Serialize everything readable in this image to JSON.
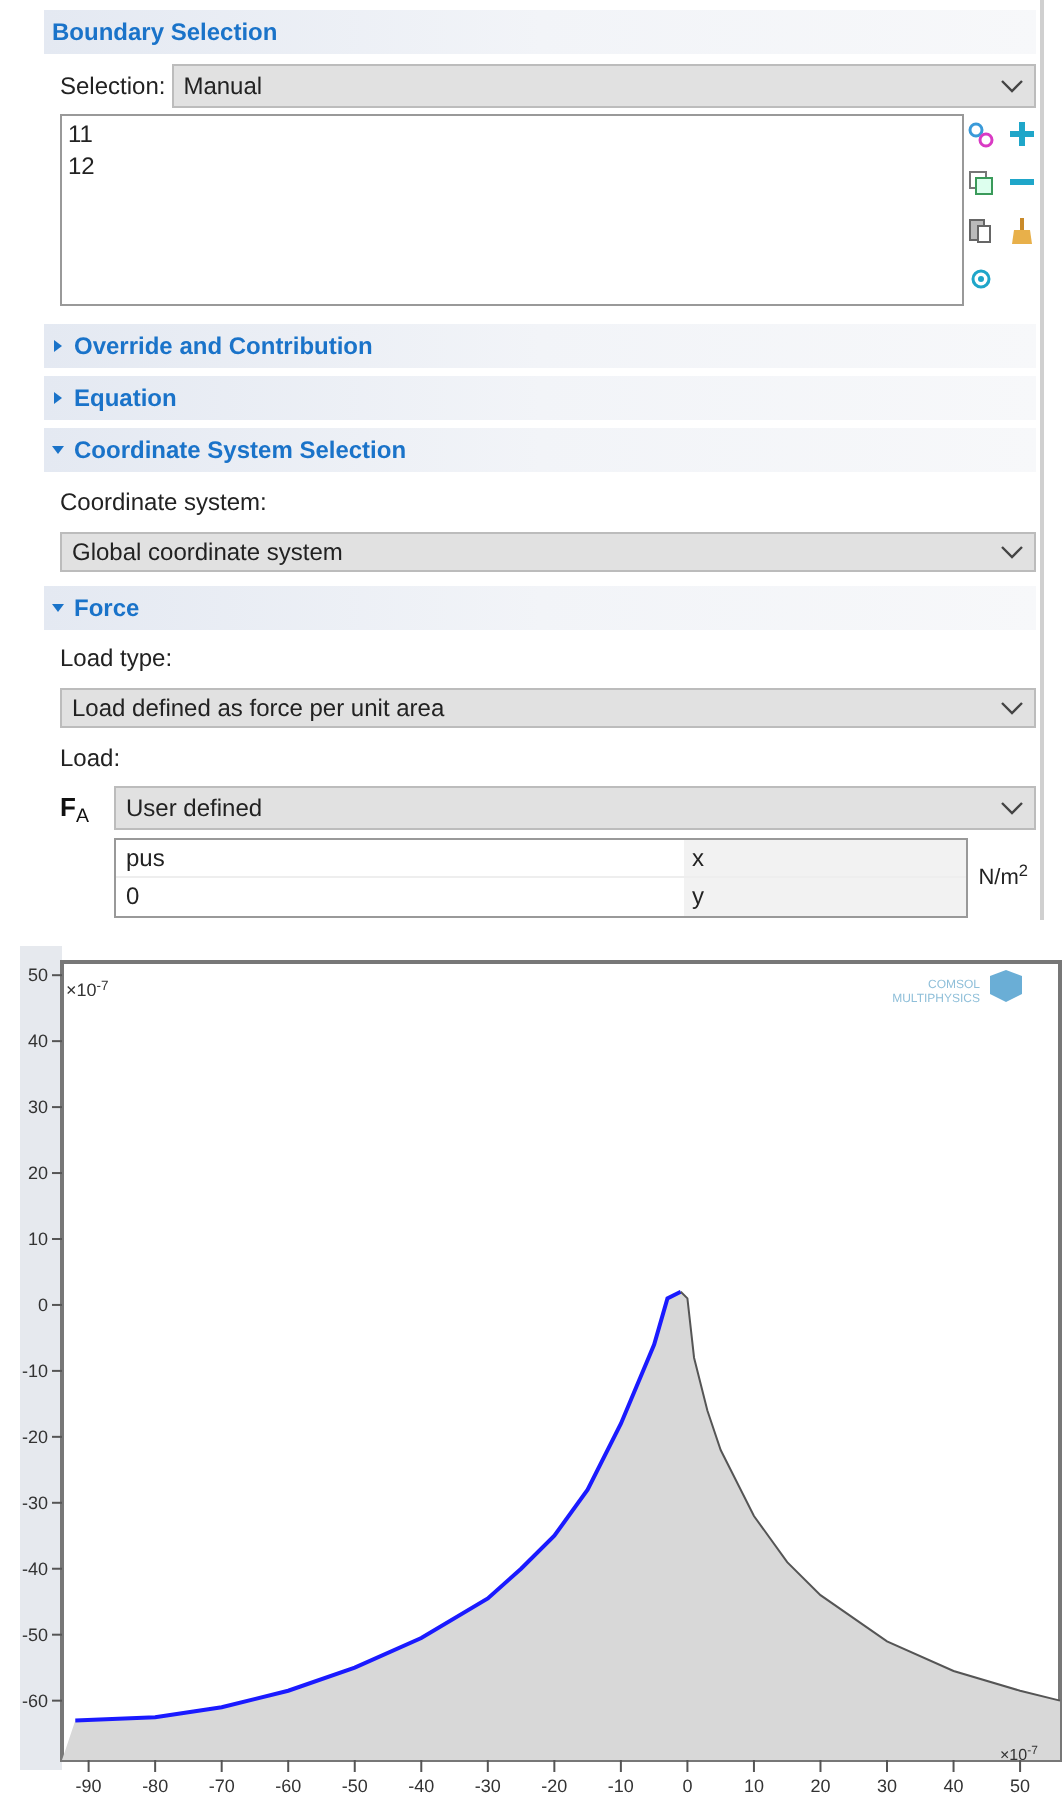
{
  "boundary_selection": {
    "title": "Boundary Selection",
    "selection_label": "Selection:",
    "selection_value": "Manual",
    "items": [
      "11",
      "12"
    ]
  },
  "sections": [
    {
      "title": "Override and Contribution",
      "expanded": false
    },
    {
      "title": "Equation",
      "expanded": false
    },
    {
      "title": "Coordinate System Selection",
      "expanded": true,
      "label": "Coordinate system:",
      "value": "Global coordinate system"
    }
  ],
  "force": {
    "title": "Force",
    "expanded": true,
    "load_type_label": "Load type:",
    "load_type_value": "Load defined as force per unit area",
    "load_label": "Load:",
    "symbol": "**F**$_{A}$",
    "load_value": "User defined",
    "rows": [
      {
        "value": "pus",
        "component": "x"
      },
      {
        "value": "0",
        "component": "y"
      }
    ],
    "unit": "N/m$^{2}$"
  },
  "plot": {
    "y_multiplier": "×10$^{-7}$",
    "x_multiplier": "×10$^{-7}$",
    "logo_text": [
      "COMSOL",
      "MULTIPHYSICS"
    ],
    "chart_data": {
      "type": "line",
      "x": [
        -92,
        -80,
        -70,
        -60,
        -50,
        -40,
        -30,
        -25,
        -20,
        -15,
        -10,
        -5,
        -3,
        -1,
        0,
        1,
        3,
        5,
        10,
        15,
        20,
        30,
        40,
        50,
        56
      ],
      "series": [
        {
          "color": "#1a1aff",
          "values": [
            -63,
            -62.5,
            -61,
            -58.5,
            -55,
            -50.5,
            -44.5,
            -40,
            -35,
            -28,
            -18,
            -6,
            1,
            2,
            null,
            null,
            null,
            null,
            null,
            null,
            null,
            null,
            null,
            null,
            null
          ]
        },
        {
          "color": "#555555",
          "values": [
            null,
            null,
            null,
            null,
            null,
            null,
            null,
            null,
            null,
            null,
            null,
            null,
            null,
            2,
            1,
            -8,
            -16,
            -22,
            -32,
            -39,
            -44,
            -51,
            -55.5,
            -58.5,
            -60
          ]
        }
      ],
      "xticks": [
        -90,
        -80,
        -70,
        -60,
        -50,
        -40,
        -30,
        -20,
        -10,
        0,
        10,
        20,
        30,
        40,
        50
      ],
      "yticks": [
        50,
        40,
        30,
        20,
        10,
        0,
        -10,
        -20,
        -30,
        -40,
        -50,
        -60
      ],
      "xlim": [
        -94,
        56
      ],
      "ylim": [
        -69,
        52
      ]
    }
  }
}
